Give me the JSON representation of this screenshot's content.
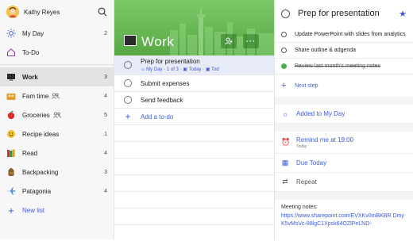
{
  "profile": {
    "name": "Kathy Reyes"
  },
  "sidebar": {
    "smart_lists": [
      {
        "label": "My Day",
        "count": "2",
        "icon": "sun-icon"
      },
      {
        "label": "To-Do",
        "count": "",
        "icon": "house-icon"
      }
    ],
    "lists": [
      {
        "label": "Work",
        "count": "3",
        "icon": "monitor-icon",
        "active": true
      },
      {
        "label": "Fam time",
        "count": "4",
        "icon": "family-icon",
        "shared": true
      },
      {
        "label": "Groceries",
        "count": "5",
        "icon": "apple-icon",
        "shared": true
      },
      {
        "label": "Recipe ideas",
        "count": "1",
        "icon": "smile-icon"
      },
      {
        "label": "Read",
        "count": "4",
        "icon": "books-icon"
      },
      {
        "label": "Backpacking",
        "count": "3",
        "icon": "backpack-icon"
      },
      {
        "label": "Patagonia",
        "count": "4",
        "icon": "airplane-icon"
      }
    ],
    "new_list": "New list"
  },
  "main": {
    "title": "Work",
    "tasks": [
      {
        "title": "Prep for presentation",
        "meta_myday": "My Day",
        "meta_steps": "1 of 3",
        "meta_today": "Today",
        "meta_more": "Tod",
        "selected": true
      },
      {
        "title": "Submit expenses"
      },
      {
        "title": "Send feedback"
      }
    ],
    "add_todo": "Add a to-do"
  },
  "detail": {
    "title": "Prep for presentation",
    "steps": [
      {
        "text": "Update PowerPoint with slides from analytics",
        "done": false
      },
      {
        "text": "Share outline & adgenda",
        "done": false
      },
      {
        "text": "Review last month's meeting notes",
        "done": true
      }
    ],
    "next_step": "Next step",
    "added_myday": "Added to My Day",
    "remind": "Remind me at 19:00",
    "remind_sub": "Today",
    "due": "Due Today",
    "repeat": "Repeat",
    "notes_label": "Meeting notes:",
    "notes_link": "https://www.sharepoint.com/EVXKv0mBKBR DmyK5vMsVc-88lgC1Xpsk64OZlPeLND-"
  },
  "colors": {
    "accent": "#3c5cd6",
    "banner": "#62b24f"
  }
}
